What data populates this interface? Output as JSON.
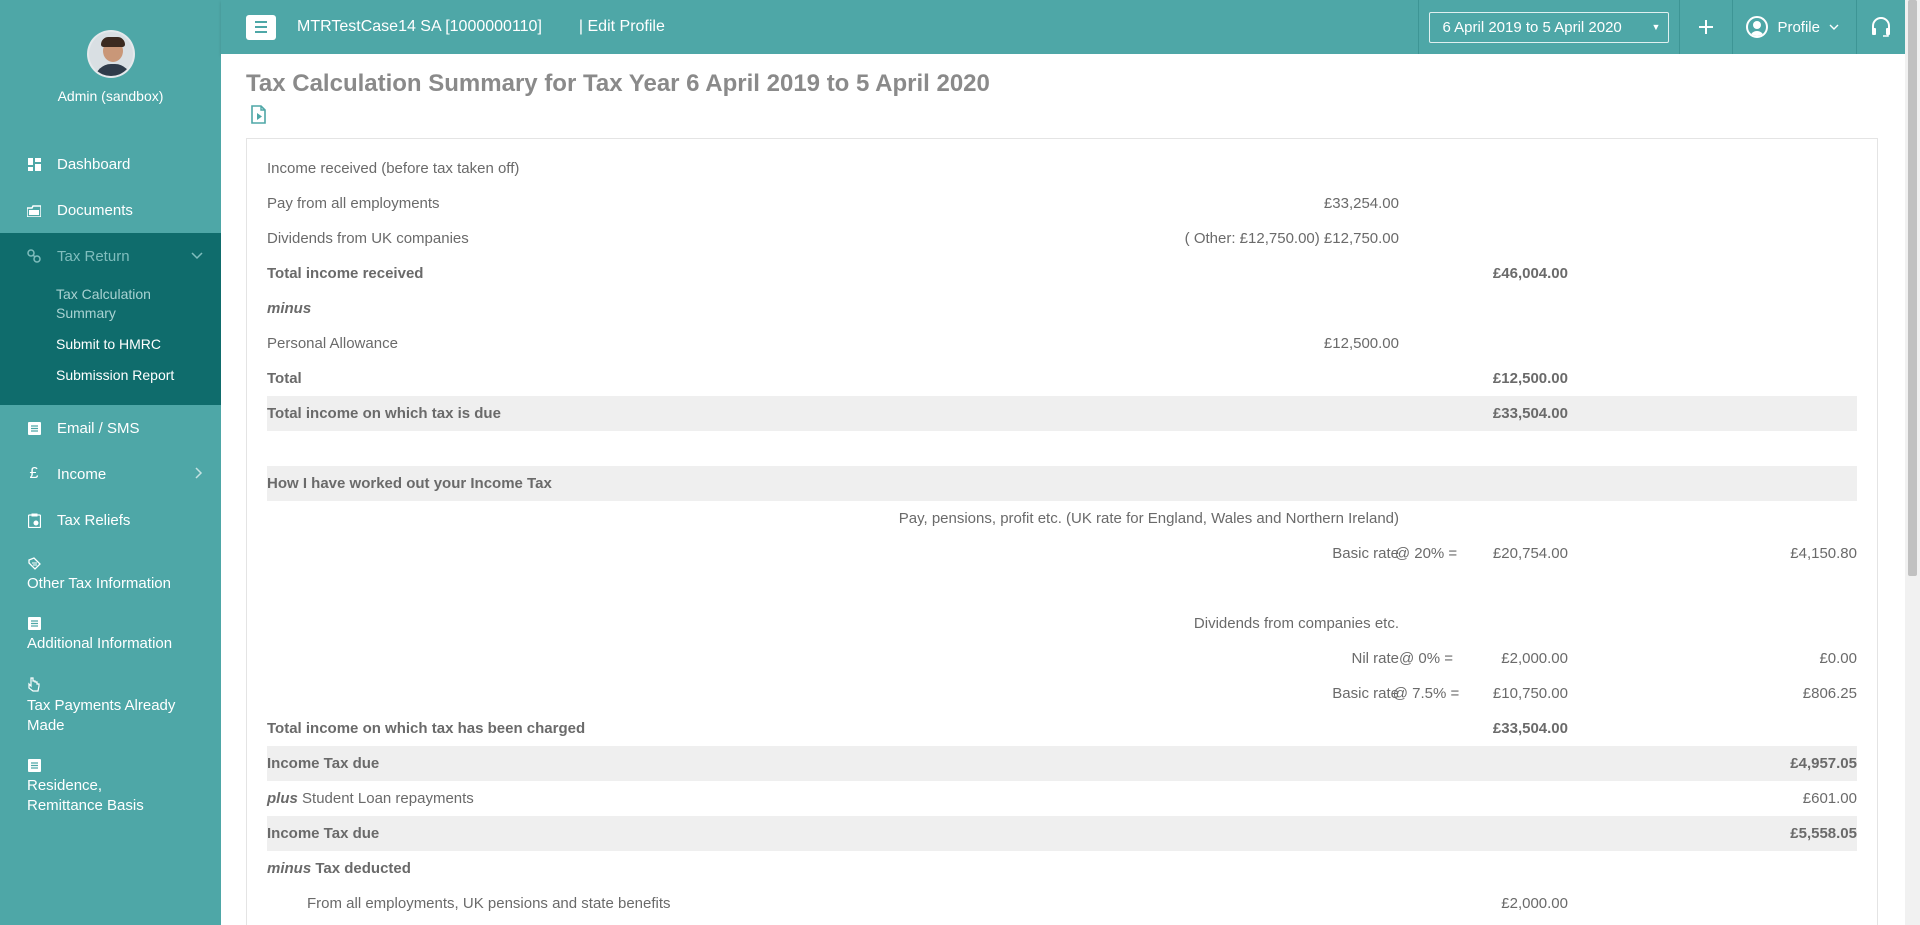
{
  "sidebar": {
    "user_name": "Admin (sandbox)",
    "items": [
      {
        "label": "Dashboard",
        "icon": "dashboard-icon"
      },
      {
        "label": "Documents",
        "icon": "documents-icon"
      },
      {
        "label": "Tax Return",
        "icon": "tax-return-icon"
      },
      {
        "label": "Email / SMS",
        "icon": "list-icon"
      },
      {
        "label": "Income",
        "icon": "pound-icon"
      },
      {
        "label": "Tax Reliefs",
        "icon": "clipboard-icon"
      },
      {
        "label": "Other Tax Information",
        "icon": "tag-icon"
      },
      {
        "label": "Additional Information",
        "icon": "list-icon"
      },
      {
        "label": "Tax Payments Already Made",
        "icon": "hand-icon"
      },
      {
        "label": "Residence, Remittance Basis",
        "icon": "list-icon"
      }
    ],
    "tax_return_sub": [
      {
        "label": "Tax Calculation Summary"
      },
      {
        "label": "Submit to HMRC"
      },
      {
        "label": "Submission Report"
      }
    ]
  },
  "topbar": {
    "client_title": "MTRTestCase14 SA [1000000110]",
    "edit_profile": "| Edit Profile",
    "tax_year": "6 April 2019 to 5 April 2020",
    "plus": "+",
    "profile_label": "Profile"
  },
  "main": {
    "page_title": "Tax Calculation Summary for Tax Year 6 April 2019 to 5 April 2020"
  },
  "calc": {
    "r1": {
      "label": "Income received (before tax taken off)"
    },
    "r2": {
      "label": "Pay from all employments",
      "c1": "£33,254.00"
    },
    "r3": {
      "label": "Dividends from UK companies",
      "c1": "( Other: £12,750.00) £12,750.00"
    },
    "r4": {
      "label": "Total income received",
      "c2": "£46,004.00"
    },
    "r5": {
      "label": "minus"
    },
    "r6": {
      "label": "Personal Allowance",
      "c1": "£12,500.00"
    },
    "r7": {
      "label": "Total",
      "c2": "£12,500.00"
    },
    "r8": {
      "label": "Total income on which tax is due",
      "c2": "£33,504.00"
    },
    "r10": {
      "label": "How I have worked out your Income Tax"
    },
    "r11": {
      "c1": "Pay, pensions, profit etc. (UK rate for England, Wales and Northern Ireland)"
    },
    "r12": {
      "c1": "Basic rate",
      "c2": "£20,754.00",
      "c3": "@ 20% =",
      "c4": "£4,150.80"
    },
    "r14": {
      "c1": "Dividends from companies etc."
    },
    "r15": {
      "c1": "Nil rate",
      "c2": "£2,000.00",
      "c3": "@ 0% =",
      "c4": "£0.00"
    },
    "r16": {
      "c1": "Basic rate",
      "c2": "£10,750.00",
      "c3": "@ 7.5% =",
      "c4": "£806.25"
    },
    "r17": {
      "label": "Total income on which tax has been charged",
      "c2": "£33,504.00"
    },
    "r18": {
      "label": "Income Tax due",
      "c4": "£4,957.05"
    },
    "r19": {
      "prefix": "plus",
      "label": "Student Loan repayments",
      "c4": "£601.00"
    },
    "r20": {
      "label": "Income Tax due",
      "c4": "£5,558.05"
    },
    "r21": {
      "prefix": "minus",
      "label": "Tax deducted"
    },
    "r22": {
      "label": "From all employments, UK pensions and state benefits",
      "c2": "£2,000.00"
    }
  },
  "colors": {
    "accent": "#4ea7a7",
    "accent_dark": "#0f6c6c",
    "shade": "#efefef"
  }
}
